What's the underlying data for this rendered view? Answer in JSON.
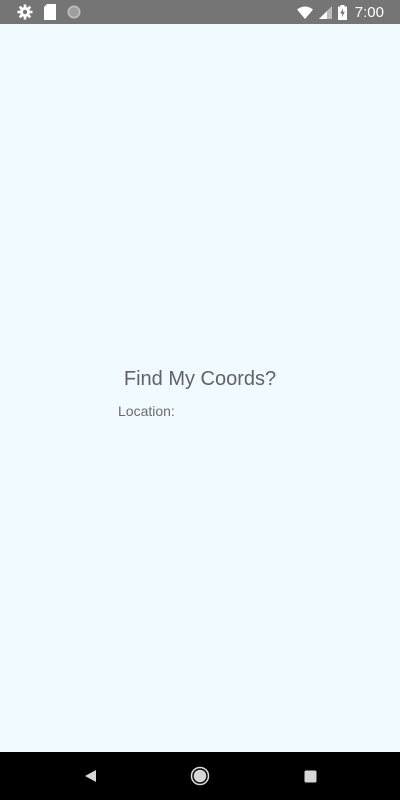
{
  "status_bar": {
    "time": "7:00",
    "left_icons": [
      "gear-icon",
      "sd-card-icon",
      "sync-circle-icon"
    ],
    "right_icons": [
      "wifi-icon",
      "cell-signal-icon",
      "battery-charging-icon"
    ]
  },
  "main": {
    "title": "Find My Coords?",
    "location_label": "Location:"
  },
  "nav_bar": {
    "buttons": [
      "back-icon",
      "home-icon",
      "recents-icon"
    ]
  },
  "colors": {
    "background": "#F1FAFE",
    "status_bar": "#757575",
    "nav_bar": "#000000",
    "text": "#5f6368"
  }
}
